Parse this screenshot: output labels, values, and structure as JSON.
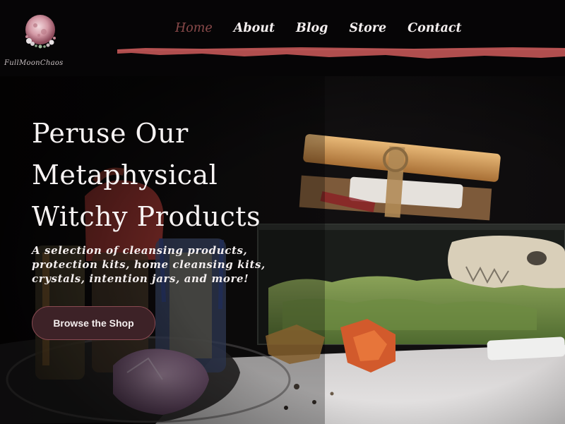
{
  "brand": {
    "name": "FullMoonChaos",
    "logo_icon": "full-moon-emblem-icon"
  },
  "nav": {
    "items": [
      {
        "label": "Home",
        "active": true
      },
      {
        "label": "About",
        "active": false
      },
      {
        "label": "Blog",
        "active": false
      },
      {
        "label": "Store",
        "active": false
      },
      {
        "label": "Contact",
        "active": false
      }
    ]
  },
  "hero": {
    "title_line1": "Peruse Our",
    "title_line2": "Metaphysical",
    "title_line3": "Witchy Products",
    "subtitle_line1": "A selection of cleansing products,",
    "subtitle_line2": "protection kits, home cleansing kits,",
    "subtitle_line3": "crystals, intention jars, and more!",
    "cta_label": "Browse the Shop"
  },
  "colors": {
    "background": "#0c0a0b",
    "header": "#060506",
    "accent_brush": "#b04e4e",
    "nav_active": "#8a4a4a",
    "cta_fill": "#3d2227",
    "cta_border": "#8a4a52",
    "text": "#f4efef"
  }
}
